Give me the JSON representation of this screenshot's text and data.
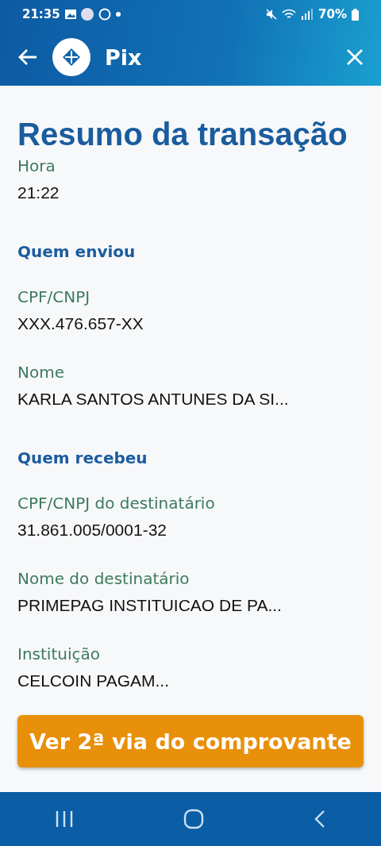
{
  "status_bar": {
    "time": "21:35",
    "battery": "70%"
  },
  "app_bar": {
    "title": "Pix"
  },
  "page": {
    "title": "Resumo da transação"
  },
  "items": [
    {
      "kind": "field",
      "label": "Hora",
      "value": "21:22"
    },
    {
      "kind": "heading",
      "label": "Quem enviou"
    },
    {
      "kind": "field",
      "label": "CPF/CNPJ",
      "value": "XXX.476.657-XX"
    },
    {
      "kind": "field",
      "label": "Nome",
      "value": "KARLA SANTOS ANTUNES DA SI..."
    },
    {
      "kind": "heading",
      "label": "Quem recebeu"
    },
    {
      "kind": "field",
      "label": "CPF/CNPJ do destinatário",
      "value": "31.861.005/0001-32"
    },
    {
      "kind": "field",
      "label": "Nome do destinatário",
      "value": "PRIMEPAG INSTITUICAO DE PA..."
    },
    {
      "kind": "field",
      "label": "Instituição",
      "value": "CELCOIN PAGAM..."
    }
  ],
  "button": {
    "label": "Ver 2ª via do comprovante"
  }
}
